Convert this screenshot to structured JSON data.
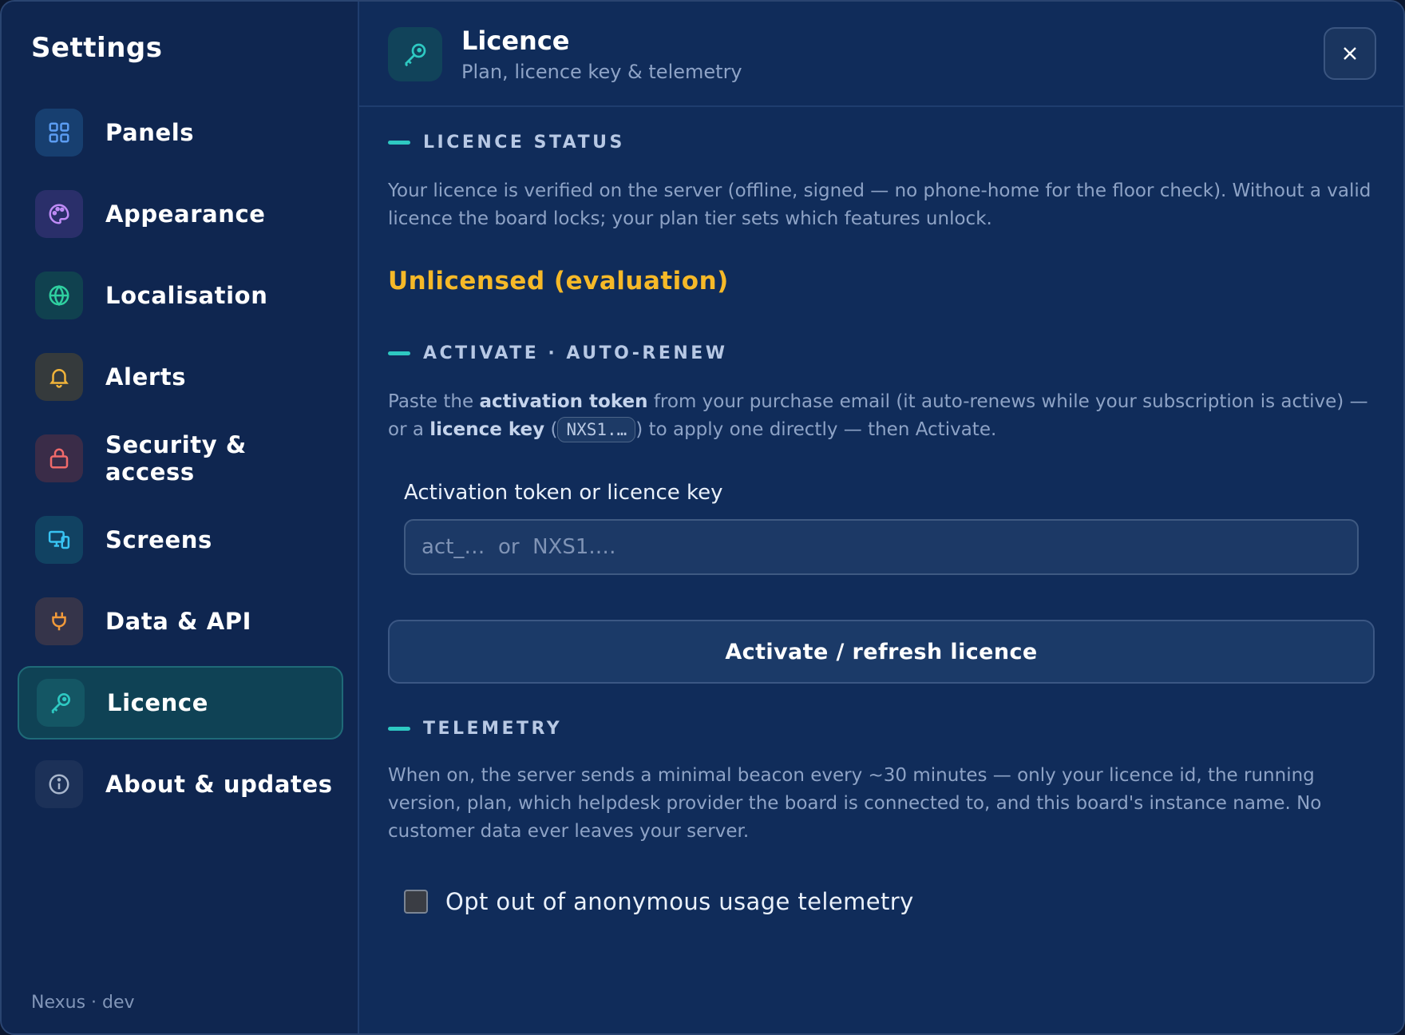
{
  "sidebar": {
    "title": "Settings",
    "items": [
      {
        "label": "Panels",
        "icon": "grid-icon",
        "color": "#5b9cf2"
      },
      {
        "label": "Appearance",
        "icon": "palette-icon",
        "color": "#c08cf7"
      },
      {
        "label": "Localisation",
        "icon": "globe-icon",
        "color": "#2fd0a0"
      },
      {
        "label": "Alerts",
        "icon": "bell-icon",
        "color": "#f2b43a"
      },
      {
        "label": "Security & access",
        "icon": "lock-icon",
        "color": "#f06a6a"
      },
      {
        "label": "Screens",
        "icon": "devices-icon",
        "color": "#38c3f2"
      },
      {
        "label": "Data & API",
        "icon": "plug-icon",
        "color": "#f29a3a"
      },
      {
        "label": "Licence",
        "icon": "key-icon",
        "color": "#2ec9c2",
        "active": true
      },
      {
        "label": "About & updates",
        "icon": "info-icon",
        "color": "#a8b6cc"
      }
    ],
    "footer": "Nexus · dev"
  },
  "header": {
    "title": "Licence",
    "subtitle": "Plan, licence key & telemetry"
  },
  "sections": {
    "status": {
      "heading": "LICENCE STATUS",
      "text": "Your licence is verified on the server (offline, signed — no phone-home for the floor check). Without a valid licence the board locks; your plan tier sets which features unlock.",
      "status_value": "Unlicensed (evaluation)"
    },
    "activate": {
      "heading": "ACTIVATE · AUTO-RENEW",
      "text_1": "Paste the ",
      "bold_1": "activation token",
      "text_2": " from your purchase email (it auto-renews while your subscription is active) — or a ",
      "bold_2": "licence key",
      "text_3": " (",
      "chip": "NXS1.…",
      "text_4": ") to apply one directly — then Activate.",
      "field_label": "Activation token or licence key",
      "field_placeholder": "act_…  or  NXS1.…",
      "field_value": "",
      "button_label": "Activate / refresh licence"
    },
    "telemetry": {
      "heading": "TELEMETRY",
      "text": "When on, the server sends a minimal beacon every ~30 minutes — only your licence id, the running version, plan, which helpdesk provider the board is connected to, and this board's instance name. No customer data ever leaves your server.",
      "checkbox_label": "Opt out of anonymous usage telemetry",
      "checkbox_checked": false
    }
  },
  "colors": {
    "accent": "#2ec9c2",
    "status_warning": "#f6b928"
  }
}
